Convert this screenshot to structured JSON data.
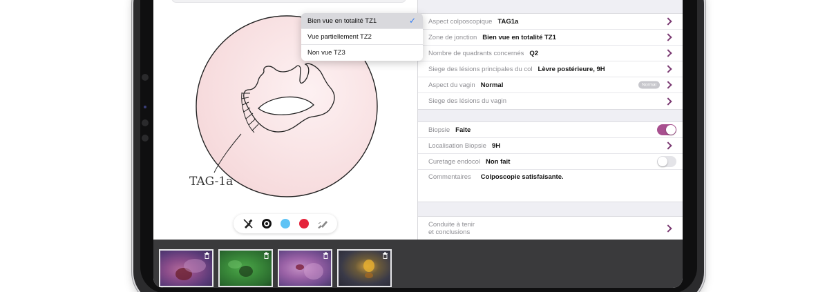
{
  "dropdown": {
    "options": [
      {
        "label": "Bien vue en totalité TZ1",
        "selected": true
      },
      {
        "label": "Vue partiellement TZ2",
        "selected": false
      },
      {
        "label": "Non vue TZ3",
        "selected": false
      }
    ]
  },
  "form": {
    "group1": [
      {
        "label": "Aspect colposcopique",
        "value": "TAG1a"
      },
      {
        "label": "Zone de jonction",
        "value": "Bien vue en totalité TZ1"
      },
      {
        "label": "Nombre de quadrants concernés",
        "value": "Q2"
      },
      {
        "label": "Siege des lésions principales du col",
        "value": "Lèvre postérieure, 9H"
      },
      {
        "label": "Aspect du vagin",
        "value": "Normal",
        "badge": "Normal"
      },
      {
        "label": "Siege des lésions du vagin",
        "value": ""
      }
    ],
    "group2": {
      "biopsie_label": "Biopsie",
      "biopsie_value": "Faite",
      "biopsie_on": true,
      "localisation_label": "Localisation Biopsie",
      "localisation_value": "9H",
      "curetage_label": "Curetage endocol",
      "curetage_value": "Non fait",
      "curetage_on": false,
      "commentaires_label": "Commentaires",
      "commentaires_value": "Colposcopie satisfaisante."
    },
    "group3": {
      "line1": "Conduite à tenir",
      "line2": "et conclusions"
    }
  },
  "drawing": {
    "annotation": "TAG-1a"
  },
  "toolbar": {
    "tools": [
      "marker-off-icon",
      "black-color",
      "light-blue-color",
      "red-color",
      "eraser-icon"
    ],
    "colors": {
      "black": "#111111",
      "light_blue": "#5ec3f5",
      "red": "#e5243b"
    }
  },
  "thumbnails": [
    "purple",
    "green",
    "purple",
    "dark-yellow"
  ],
  "colors": {
    "accent": "#a8508f",
    "check": "#2f7bf6"
  }
}
